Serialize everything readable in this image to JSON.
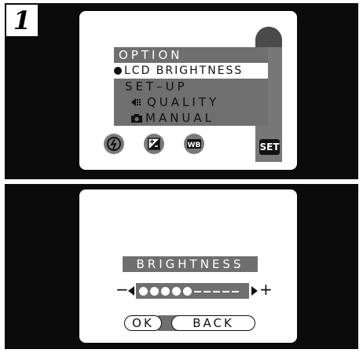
{
  "step": {
    "number": "1"
  },
  "menu_screen": {
    "title": "OPTION",
    "items": [
      {
        "label": "LCD BRIGHTNESS",
        "selected": true
      },
      {
        "label": "SET–UP"
      },
      {
        "label": "QUALITY",
        "icon": "quality-icon"
      },
      {
        "label": "MANUAL",
        "icon": "camera-icon"
      }
    ],
    "bottom_icons": [
      "flash-off-icon",
      "exposure-compensation-icon",
      "white-balance-icon"
    ],
    "white_balance_label": "WB",
    "set_label": "SET"
  },
  "brightness_screen": {
    "title": "BRIGHTNESS",
    "minus": "−",
    "plus": "+",
    "level": 5,
    "max_level": 10,
    "ok_label": "OK",
    "back_label": "BACK"
  },
  "colors": {
    "panel": "#0b0b0b",
    "highlight": "#6f6f6f",
    "screen": "#ffffff"
  }
}
